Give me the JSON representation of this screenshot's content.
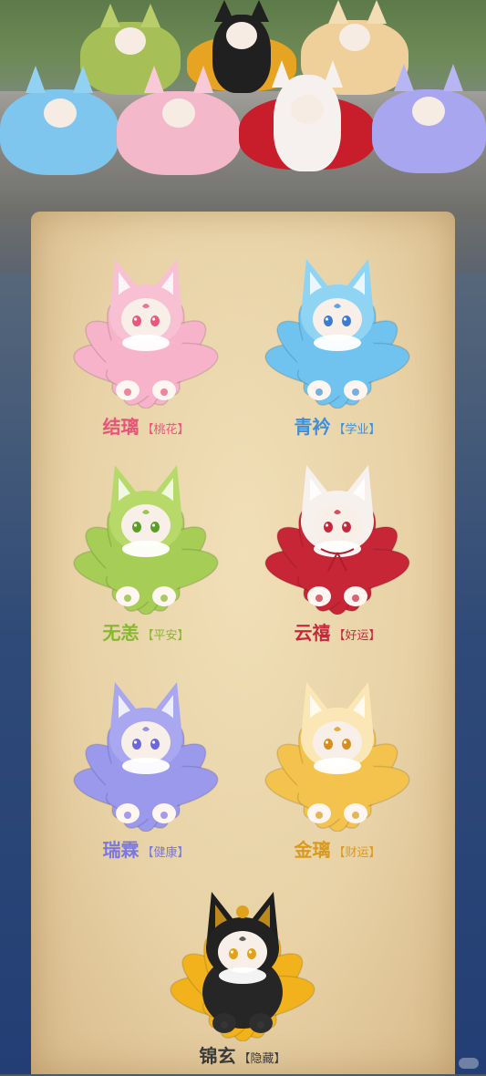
{
  "colors": {
    "pink": "#e8547a",
    "blue": "#3f8fd8",
    "green": "#86b82e",
    "red": "#c42a3c",
    "purple": "#7a78e0",
    "gold": "#d99a1e",
    "black": "#3a3a3a"
  },
  "characters": [
    {
      "name": "结璃",
      "tag": "【桃花】",
      "color": "#e8547a",
      "fur": "#f6b3c9",
      "ears": "#f7c1d3",
      "eyes": "#e65a7a"
    },
    {
      "name": "青衿",
      "tag": "【学业】",
      "color": "#3f8fd8",
      "fur": "#6fc3ee",
      "ears": "#8fd4f3",
      "eyes": "#3d7ad0"
    },
    {
      "name": "无恙",
      "tag": "【平安】",
      "color": "#86b82e",
      "fur": "#a6cd55",
      "ears": "#b7d96a",
      "eyes": "#5b9e26"
    },
    {
      "name": "云禧",
      "tag": "【好运】",
      "color": "#c42a3c",
      "fur": "#c72636",
      "ears": "#f7f1ee",
      "eyes": "#c4283a"
    },
    {
      "name": "瑞霖",
      "tag": "【健康】",
      "color": "#7a78e0",
      "fur": "#9a99ec",
      "ears": "#a9a7f0",
      "eyes": "#6c67d8"
    },
    {
      "name": "金璃",
      "tag": "【财运】",
      "color": "#d99a1e",
      "fur": "#f4c34d",
      "ears": "#fbe7b6",
      "eyes": "#d58d1f"
    },
    {
      "name": "锦玄",
      "tag": "【隐藏】",
      "color": "#3a3a3a",
      "fur": "#f2b21c",
      "ears": "#2a2a2a",
      "eyes": "#e0a21a"
    }
  ]
}
